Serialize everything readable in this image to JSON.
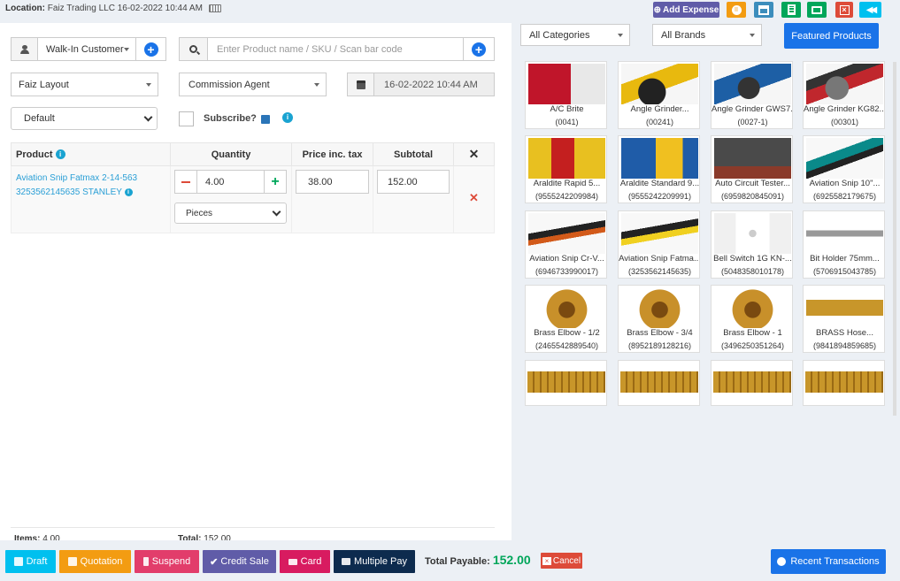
{
  "topbar": {
    "location_label": "Location:",
    "location_value": "Faiz Trading LLC",
    "datetime": "16-02-2022 10:44 AM",
    "add_expense": "Add Expense",
    "colors": {
      "purple": "#605ca8",
      "orange": "#f39c12",
      "blue": "#3c8dbc",
      "green": "#00a65a",
      "red": "#dd4b39",
      "cyan": "#00c0ef"
    }
  },
  "form": {
    "customer": "Walk-In Customer",
    "product_search_placeholder": "Enter Product name / SKU / Scan bar code",
    "layout": "Faiz Layout",
    "commission_agent": "Commission Agent",
    "transaction_date": "16-02-2022 10:44 AM",
    "price_group": "Default",
    "subscribe_label": "Subscribe?"
  },
  "table": {
    "headers": {
      "product": "Product",
      "quantity": "Quantity",
      "price": "Price inc. tax",
      "subtotal": "Subtotal"
    },
    "row": {
      "name": "Aviation Snip Fatmax 2-14-563",
      "sku_brand": "3253562145635 STANLEY",
      "quantity": "4.00",
      "unit": "Pieces",
      "price": "38.00",
      "subtotal": "152.00"
    }
  },
  "totals": {
    "items_label": "Items:",
    "items_value": "4.00",
    "total_label": "Total:",
    "total_value": "152.00"
  },
  "filters": {
    "category": "All Categories",
    "brand": "All Brands",
    "featured": "Featured Products"
  },
  "products": [
    {
      "name": "A/C Brite",
      "sku": "(0041)"
    },
    {
      "name": "Angle Grinder...",
      "sku": "(00241)"
    },
    {
      "name": "Angle Grinder GWS7...",
      "sku": "(0027-1)"
    },
    {
      "name": "Angle Grinder KG82...",
      "sku": "(00301)"
    },
    {
      "name": "Araldite Rapid 5...",
      "sku": "(9555242209984)"
    },
    {
      "name": "Araldite Standard 9...",
      "sku": "(9555242209991)"
    },
    {
      "name": "Auto Circuit Tester...",
      "sku": "(6959820845091)"
    },
    {
      "name": "Aviation Snip 10\"...",
      "sku": "(6925582179675)"
    },
    {
      "name": "Aviation Snip Cr-V...",
      "sku": "(6946733990017)"
    },
    {
      "name": "Aviation Snip Fatma...",
      "sku": "(3253562145635)"
    },
    {
      "name": "Bell Switch 1G KN-...",
      "sku": "(5048358010178)"
    },
    {
      "name": "Bit Holder 75mm...",
      "sku": "(5706915043785)"
    },
    {
      "name": "Brass Elbow - 1/2",
      "sku": "(2465542889540)"
    },
    {
      "name": "Brass Elbow - 3/4",
      "sku": "(8952189128216)"
    },
    {
      "name": "Brass Elbow - 1",
      "sku": "(3496250351264)"
    },
    {
      "name": "BRASS Hose...",
      "sku": "(9841894859685)"
    }
  ],
  "footer": {
    "draft": "Draft",
    "quotation": "Quotation",
    "suspend": "Suspend",
    "credit_sale": "Credit Sale",
    "card": "Card",
    "multiple_pay": "Multiple Pay",
    "total_payable_label": "Total Payable:",
    "total_payable_value": "152.00",
    "cancel": "Cancel",
    "recent_transactions": "Recent Transactions"
  }
}
